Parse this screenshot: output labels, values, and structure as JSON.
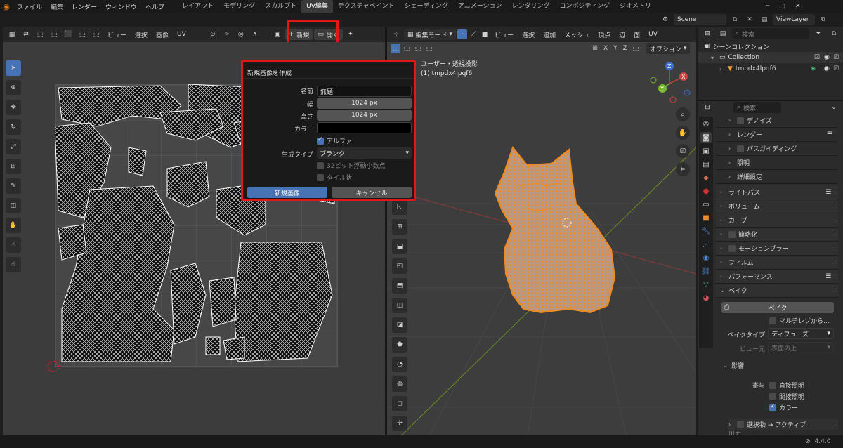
{
  "topbar": {
    "menus": [
      "ファイル",
      "編集",
      "レンダー",
      "ウィンドウ",
      "ヘルプ"
    ],
    "tabs": [
      "レイアウト",
      "モデリング",
      "スカルプト",
      "UV編集",
      "テクスチャペイント",
      "シェーディング",
      "アニメーション",
      "レンダリング",
      "コンポジティング",
      "ジオメトリ"
    ],
    "scene": "Scene",
    "viewlayer": "ViewLayer"
  },
  "uv_header": {
    "view": "ビュー",
    "select": "選択",
    "image": "画像",
    "uv": "UV",
    "new": "新規",
    "open": "開く"
  },
  "dialog": {
    "title": "新規画像を作成",
    "name_label": "名前",
    "name_value": "無題",
    "width_label": "幅",
    "width_value": "1024 px",
    "height_label": "高さ",
    "height_value": "1024 px",
    "color_label": "カラー",
    "alpha_label": "アルファ",
    "gen_type_label": "生成タイプ",
    "gen_type_value": "ブランク",
    "float_label": "32ビット浮動小数点",
    "tiled_label": "タイル状",
    "new_button": "新規画像",
    "cancel_button": "キャンセル"
  },
  "viewport": {
    "mode": "編集モード",
    "view": "ビュー",
    "select": "選択",
    "add": "追加",
    "mesh": "メッシュ",
    "vertex": "頂点",
    "edge": "辺",
    "face": "面",
    "uv": "UV",
    "axis_x": "X",
    "axis_y": "Y",
    "axis_z": "Z",
    "options": "オプション",
    "persp": "ユーザー・透視投影",
    "object": "(1) tmpdx4lpqf6",
    "accent": "#f08a1c"
  },
  "outliner": {
    "search_placeholder": "検索",
    "scene_collection": "シーンコレクション",
    "collection": "Collection",
    "object": "tmpdx4lpqf6"
  },
  "properties": {
    "search_placeholder": "検索",
    "rows": [
      "デノイズ",
      "レンダー",
      "パスガイディング",
      "照明",
      "詳細設定",
      "ライトパス",
      "ボリューム",
      "カーブ",
      "簡略化",
      "モーションブラー",
      "フィルム",
      "パフォーマンス",
      "ベイク"
    ],
    "bake_button": "ベイク",
    "multires": "マルチレゾから...",
    "bake_type_label": "ベイクタイプ",
    "bake_type_value": "ディフューズ",
    "view_from_label": "ビュー元",
    "view_from_value": "表面の上",
    "influence": "影響",
    "contrib_label": "寄与",
    "direct": "直接照明",
    "indirect": "間接照明",
    "color": "カラー",
    "selected_to_active": "選択物 → アクティブ",
    "output": "出力"
  },
  "status": {
    "version": "4.4.0"
  }
}
